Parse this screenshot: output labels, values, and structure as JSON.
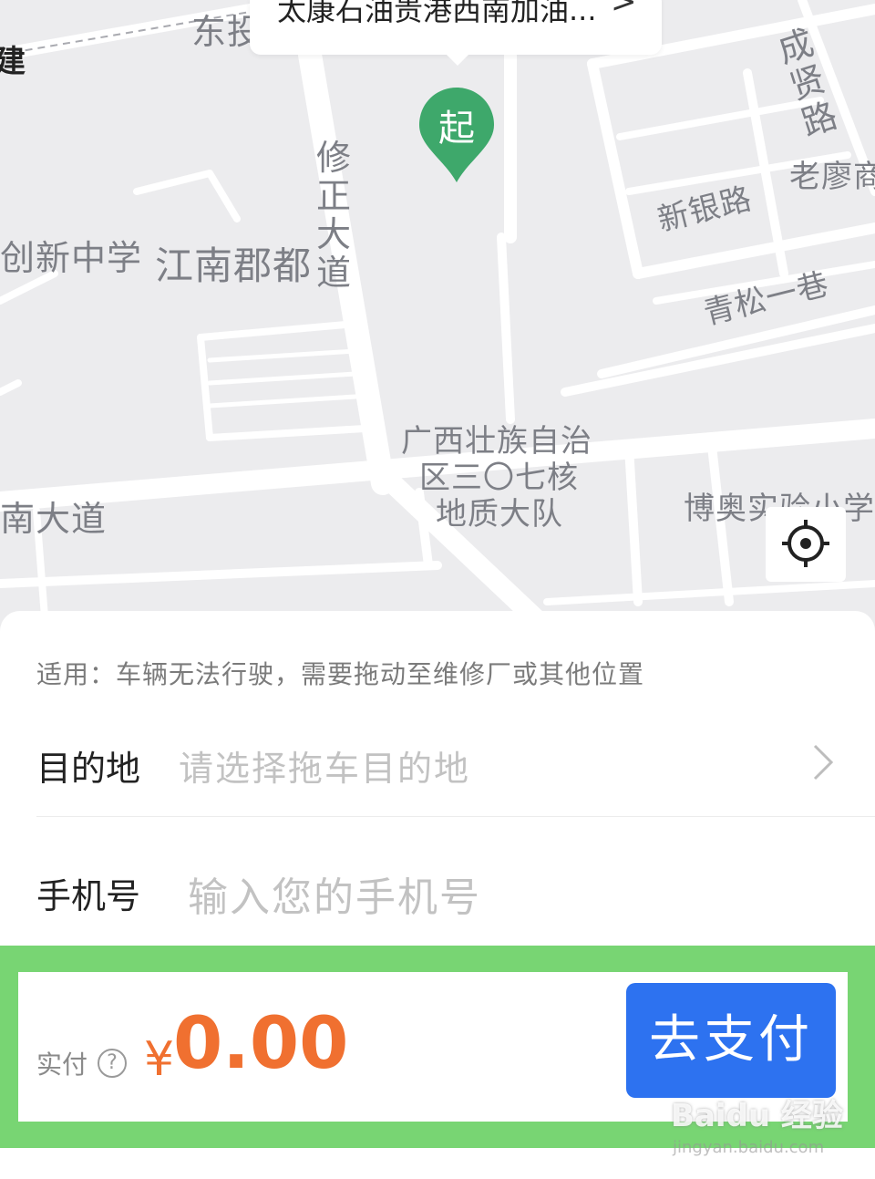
{
  "map": {
    "labels": {
      "dongtou": "东投",
      "chuangxin_school": "创新中学",
      "jiangnan_jundu": "江南郡都",
      "xiuzheng_avenue": "修正大道",
      "guangxi_team_l1": "广西壮族自治",
      "guangxi_team_l2": "区三〇七核",
      "guangxi_team_l3": "地质大队",
      "nan_avenue": "南大道",
      "boao_school": "博奥实验小学",
      "chengxu_road": "成贤路",
      "laoliao": "老廖商",
      "xinyin_road": "新银路",
      "qingsong_lane": "青松一巷",
      "edge_char": "建"
    },
    "start_location": "太康石油贵港西南加油...",
    "start_pin_label": "起"
  },
  "sheet": {
    "applicable_text": "适用：车辆无法行驶，需要拖动至维修厂或其他位置",
    "destination_label": "目的地",
    "destination_placeholder": "请选择拖车目的地",
    "phone_label": "手机号",
    "phone_placeholder": "输入您的手机号"
  },
  "footer": {
    "paid_label": "实付",
    "help_symbol": "?",
    "currency": "¥",
    "amount": "0.00",
    "pay_button": "去支付"
  },
  "watermark": {
    "brand": "Baidu 经验",
    "url": "jingyan.baidu.com"
  },
  "colors": {
    "pin_green": "#3ea86b",
    "amount_orange": "#f07030",
    "pay_blue": "#2d72f0",
    "highlight_green": "#78d573"
  },
  "icons": [
    "start-pin-icon",
    "locate-icon",
    "chevron-right-icon",
    "help-icon"
  ]
}
